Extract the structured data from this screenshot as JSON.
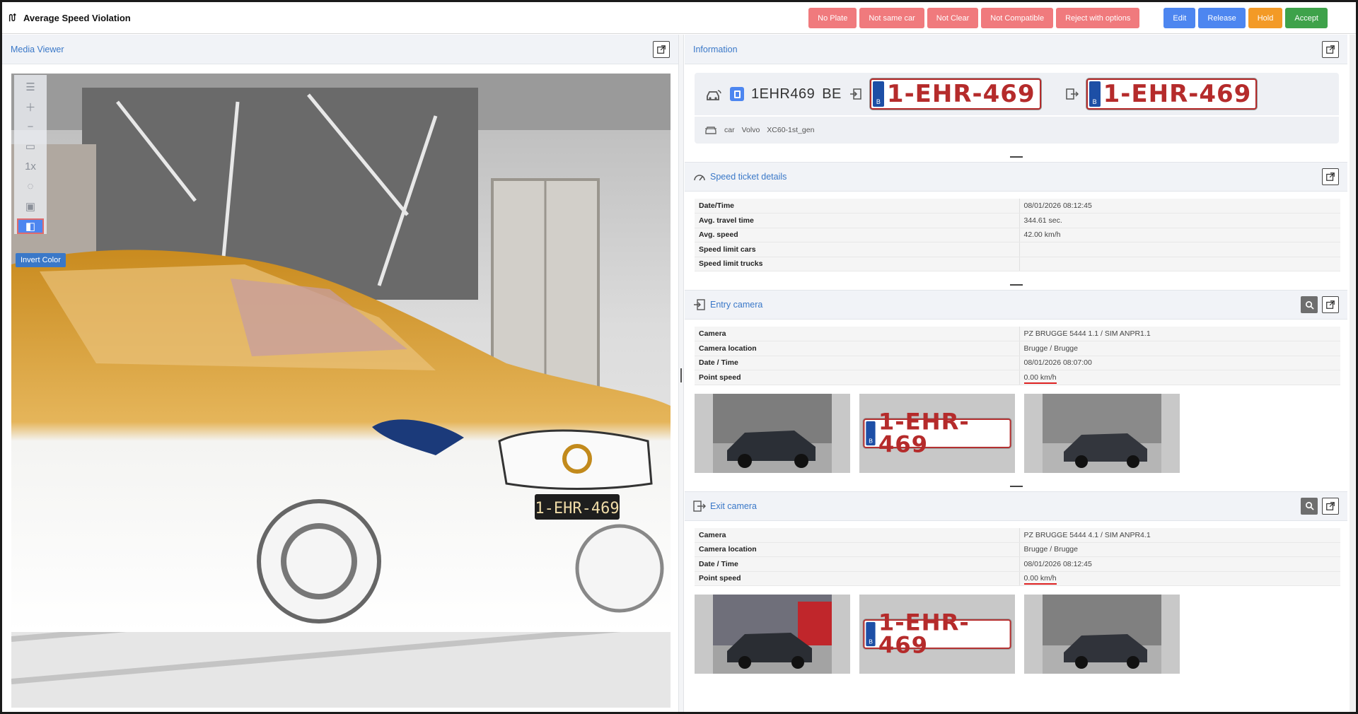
{
  "app": {
    "title": "Average Speed Violation"
  },
  "actions": [
    {
      "label": "No Plate",
      "color": "#f07a7d"
    },
    {
      "label": "Not same car",
      "color": "#f07a7d"
    },
    {
      "label": "Not Clear",
      "color": "#f07a7d"
    },
    {
      "label": "Not Compatible",
      "color": "#f07a7d"
    },
    {
      "label": "Reject with options",
      "color": "#f07a7d"
    },
    {
      "label": "Edit",
      "color": "#4d86f0"
    },
    {
      "label": "Release",
      "color": "#4d86f0"
    },
    {
      "label": "Hold",
      "color": "#f39a26"
    },
    {
      "label": "Accept",
      "color": "#3ea24a"
    }
  ],
  "media_viewer": {
    "title": "Media Viewer",
    "zoom_label": "1x",
    "tooltip": "Invert Color",
    "image_plate": "1-EHR-469"
  },
  "information": {
    "title": "Information",
    "plate_text": "1EHR469",
    "country": "BE",
    "plate_image_text": "1-EHR-469",
    "eu_letter": "B",
    "vehicle_type": "car",
    "make": "Volvo",
    "model": "XC60-1st_gen"
  },
  "speed_ticket": {
    "title": "Speed ticket details",
    "rows": [
      {
        "key": "Date/Time",
        "value": "08/01/2026 08:12:45"
      },
      {
        "key": "Avg. travel time",
        "value": "344.61 sec."
      },
      {
        "key": "Avg. speed",
        "value": "42.00 km/h"
      },
      {
        "key": "Speed limit cars",
        "value": ""
      },
      {
        "key": "Speed limit trucks",
        "value": ""
      }
    ]
  },
  "entry_camera": {
    "title": "Entry camera",
    "rows": [
      {
        "key": "Camera",
        "value": "PZ BRUGGE 5444 1.1 / SIM ANPR1.1"
      },
      {
        "key": "Camera location",
        "value": "Brugge / Brugge"
      },
      {
        "key": "Date / Time",
        "value": "08/01/2026 08:07:00"
      },
      {
        "key": "Point speed",
        "value": "0.00 km/h"
      }
    ]
  },
  "exit_camera": {
    "title": "Exit camera",
    "rows": [
      {
        "key": "Camera",
        "value": "PZ BRUGGE 5444 4.1 / SIM ANPR4.1"
      },
      {
        "key": "Camera location",
        "value": "Brugge / Brugge"
      },
      {
        "key": "Date / Time",
        "value": "08/01/2026 08:12:45"
      },
      {
        "key": "Point speed",
        "value": "0.00 km/h"
      }
    ]
  }
}
